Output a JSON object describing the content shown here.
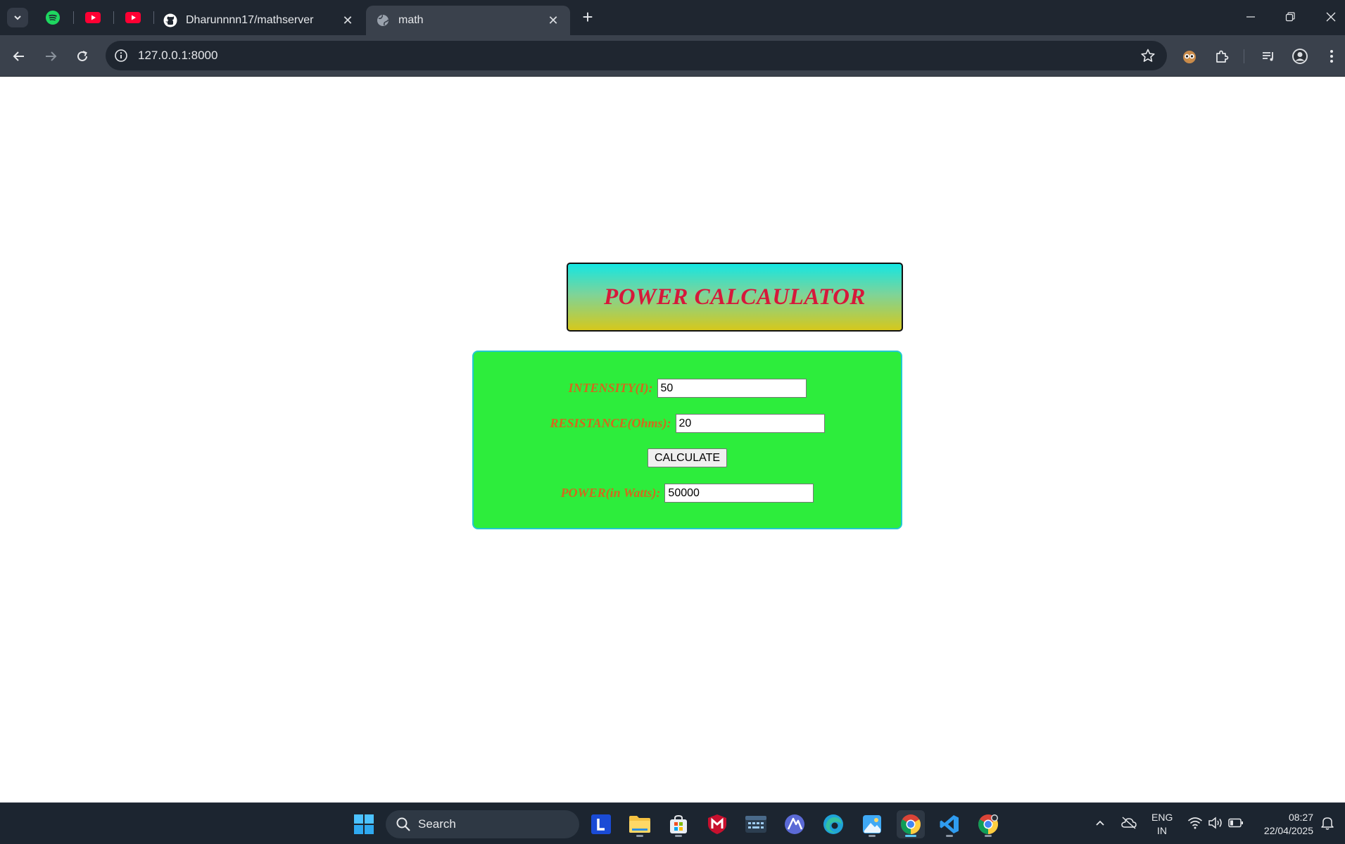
{
  "browser": {
    "tabs": [
      {
        "title": "Dharunnnn17/mathserver",
        "icon": "github-icon"
      },
      {
        "title": "math",
        "icon": "globe-icon",
        "active": true
      }
    ],
    "pinned_tabs": [
      "spotify-icon",
      "youtube-icon",
      "youtube-icon"
    ],
    "url": "127.0.0.1:8000"
  },
  "page": {
    "title": "POWER CALCAULATOR",
    "intensity_label": "INTENSITY(I):",
    "intensity_value": "50",
    "resistance_label": "RESISTANCE(Ohms):",
    "resistance_value": "20",
    "calculate_label": "CALCULATE",
    "power_label": "POWER(in Watts):",
    "power_value": "50000",
    "colors": {
      "title_text": "#d6183a",
      "label_text": "#d2691e",
      "form_bg": "#2ded3c",
      "form_border": "#22c8d0",
      "title_gradient_top": "#14e6e2",
      "title_gradient_bottom": "#d6c81c"
    }
  },
  "taskbar": {
    "search_label": "Search",
    "lang_line1": "ENG",
    "lang_line2": "IN",
    "time": "08:27",
    "date": "22/04/2025",
    "apps": [
      "windows-start-icon",
      "lens-l-icon",
      "file-explorer-icon",
      "ms-store-icon",
      "mcafee-icon",
      "terminal-icon",
      "arc-app-icon",
      "edge-icon",
      "photos-icon",
      "chrome-icon",
      "vscode-icon",
      "chrome-profile-icon"
    ]
  }
}
